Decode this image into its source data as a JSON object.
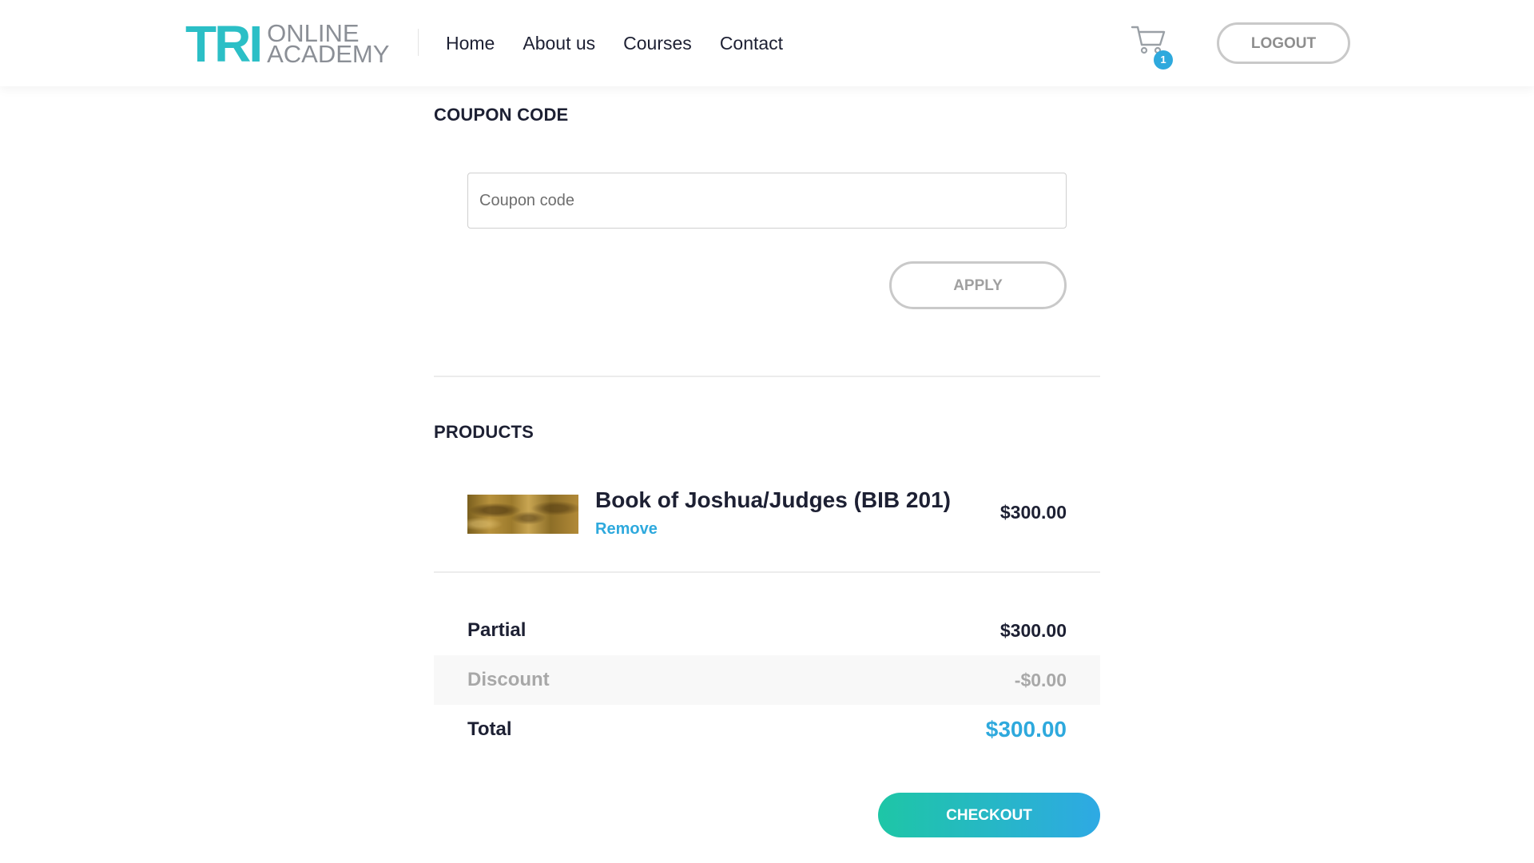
{
  "header": {
    "logo": {
      "mark": "TRI",
      "line1": "ONLINE",
      "line2": "ACADEMY"
    },
    "nav": [
      {
        "label": "Home"
      },
      {
        "label": "About us"
      },
      {
        "label": "Courses"
      },
      {
        "label": "Contact"
      }
    ],
    "cart": {
      "icon": "cart-icon",
      "count": "1"
    },
    "logout_label": "LOGOUT"
  },
  "coupon": {
    "title": "COUPON CODE",
    "input_value": "",
    "placeholder": "Coupon code",
    "apply_label": "APPLY"
  },
  "products": {
    "title": "PRODUCTS",
    "items": [
      {
        "name": "Book of Joshua/Judges (BIB 201)",
        "remove_label": "Remove",
        "price": "$300.00"
      }
    ]
  },
  "summary": {
    "partial": {
      "label": "Partial",
      "value": "$300.00"
    },
    "discount": {
      "label": "Discount",
      "value": "-$0.00"
    },
    "total": {
      "label": "Total",
      "value": "$300.00"
    }
  },
  "checkout_label": "CHECKOUT",
  "colors": {
    "accent": "#2ea9dd",
    "brand_teal": "#2bbfc6",
    "text_dark": "#1d2033",
    "checkout_gradient_start": "#1ec6a6",
    "checkout_gradient_end": "#2ea9e4"
  }
}
